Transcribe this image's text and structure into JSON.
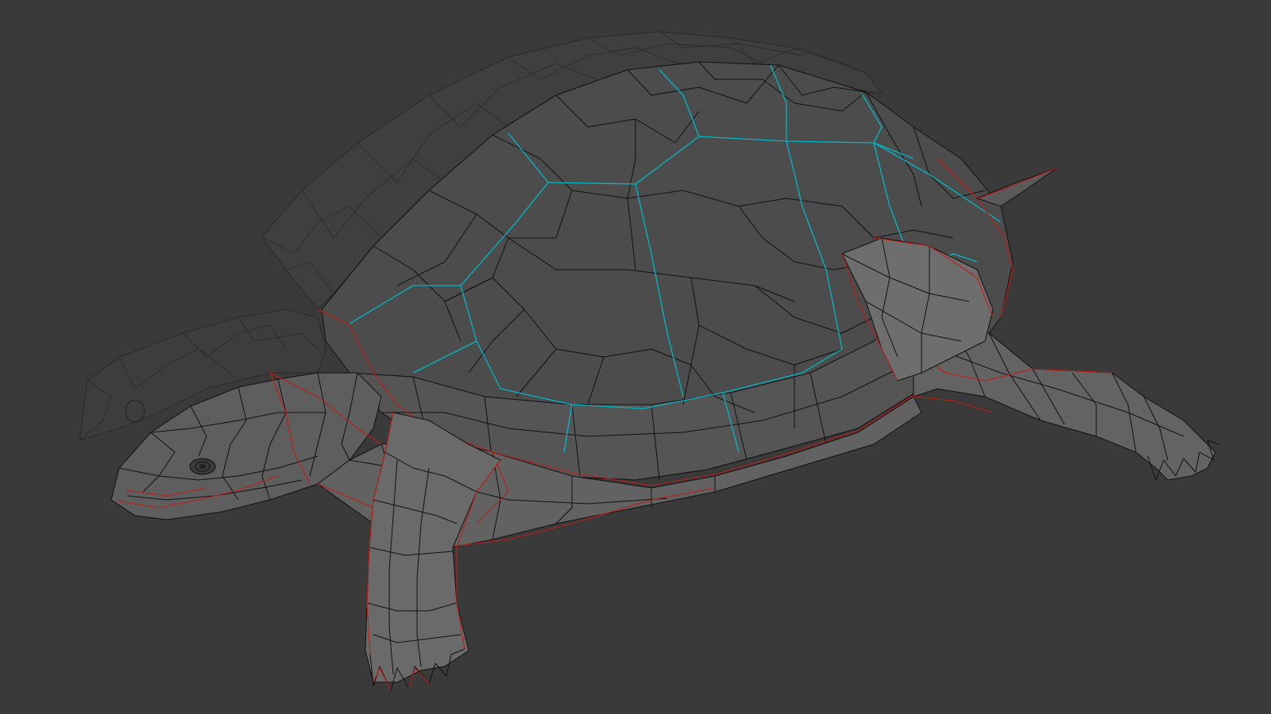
{
  "viewport": {
    "background": "#3a3a3a",
    "mode": "wireframe-overlay",
    "object": "turtle-mesh"
  },
  "colors": {
    "mesh_fill_shell": "#4e4e4e",
    "mesh_fill_body": "#6b6b6b",
    "mesh_fill_ghost": "#3f3f3f",
    "wire": "#111111",
    "seam": "#00b8c8",
    "crease": "#c01e14"
  }
}
